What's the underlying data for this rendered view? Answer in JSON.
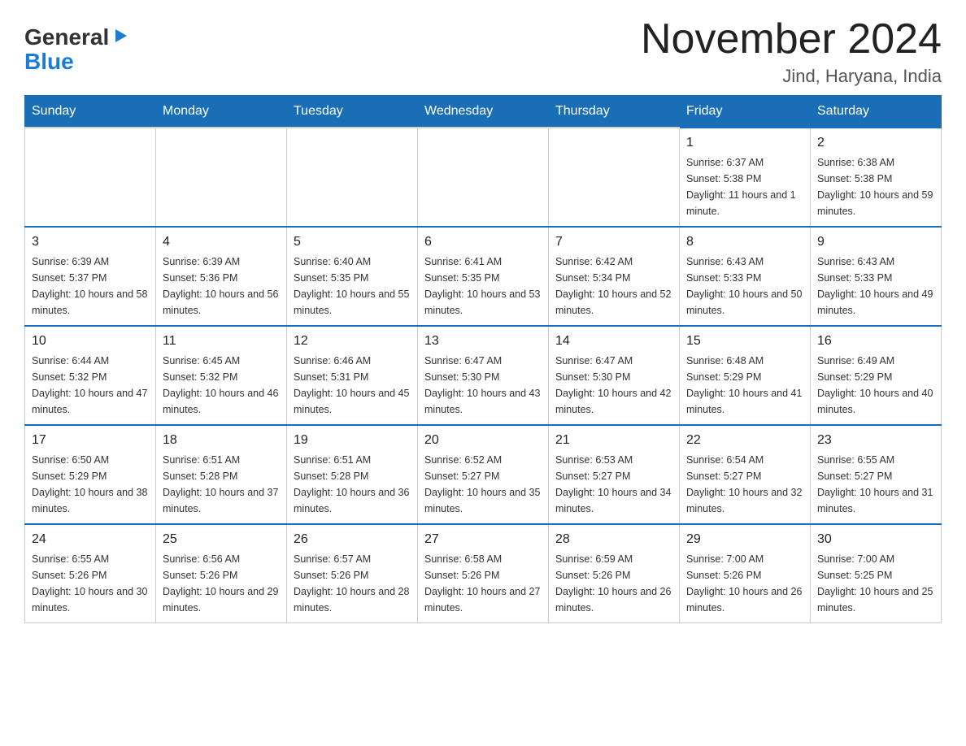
{
  "header": {
    "logo_general": "General",
    "logo_blue": "Blue",
    "month_title": "November 2024",
    "subtitle": "Jind, Haryana, India"
  },
  "days_of_week": [
    "Sunday",
    "Monday",
    "Tuesday",
    "Wednesday",
    "Thursday",
    "Friday",
    "Saturday"
  ],
  "weeks": [
    [
      {
        "num": "",
        "info": ""
      },
      {
        "num": "",
        "info": ""
      },
      {
        "num": "",
        "info": ""
      },
      {
        "num": "",
        "info": ""
      },
      {
        "num": "",
        "info": ""
      },
      {
        "num": "1",
        "info": "Sunrise: 6:37 AM\nSunset: 5:38 PM\nDaylight: 11 hours and 1 minute."
      },
      {
        "num": "2",
        "info": "Sunrise: 6:38 AM\nSunset: 5:38 PM\nDaylight: 10 hours and 59 minutes."
      }
    ],
    [
      {
        "num": "3",
        "info": "Sunrise: 6:39 AM\nSunset: 5:37 PM\nDaylight: 10 hours and 58 minutes."
      },
      {
        "num": "4",
        "info": "Sunrise: 6:39 AM\nSunset: 5:36 PM\nDaylight: 10 hours and 56 minutes."
      },
      {
        "num": "5",
        "info": "Sunrise: 6:40 AM\nSunset: 5:35 PM\nDaylight: 10 hours and 55 minutes."
      },
      {
        "num": "6",
        "info": "Sunrise: 6:41 AM\nSunset: 5:35 PM\nDaylight: 10 hours and 53 minutes."
      },
      {
        "num": "7",
        "info": "Sunrise: 6:42 AM\nSunset: 5:34 PM\nDaylight: 10 hours and 52 minutes."
      },
      {
        "num": "8",
        "info": "Sunrise: 6:43 AM\nSunset: 5:33 PM\nDaylight: 10 hours and 50 minutes."
      },
      {
        "num": "9",
        "info": "Sunrise: 6:43 AM\nSunset: 5:33 PM\nDaylight: 10 hours and 49 minutes."
      }
    ],
    [
      {
        "num": "10",
        "info": "Sunrise: 6:44 AM\nSunset: 5:32 PM\nDaylight: 10 hours and 47 minutes."
      },
      {
        "num": "11",
        "info": "Sunrise: 6:45 AM\nSunset: 5:32 PM\nDaylight: 10 hours and 46 minutes."
      },
      {
        "num": "12",
        "info": "Sunrise: 6:46 AM\nSunset: 5:31 PM\nDaylight: 10 hours and 45 minutes."
      },
      {
        "num": "13",
        "info": "Sunrise: 6:47 AM\nSunset: 5:30 PM\nDaylight: 10 hours and 43 minutes."
      },
      {
        "num": "14",
        "info": "Sunrise: 6:47 AM\nSunset: 5:30 PM\nDaylight: 10 hours and 42 minutes."
      },
      {
        "num": "15",
        "info": "Sunrise: 6:48 AM\nSunset: 5:29 PM\nDaylight: 10 hours and 41 minutes."
      },
      {
        "num": "16",
        "info": "Sunrise: 6:49 AM\nSunset: 5:29 PM\nDaylight: 10 hours and 40 minutes."
      }
    ],
    [
      {
        "num": "17",
        "info": "Sunrise: 6:50 AM\nSunset: 5:29 PM\nDaylight: 10 hours and 38 minutes."
      },
      {
        "num": "18",
        "info": "Sunrise: 6:51 AM\nSunset: 5:28 PM\nDaylight: 10 hours and 37 minutes."
      },
      {
        "num": "19",
        "info": "Sunrise: 6:51 AM\nSunset: 5:28 PM\nDaylight: 10 hours and 36 minutes."
      },
      {
        "num": "20",
        "info": "Sunrise: 6:52 AM\nSunset: 5:27 PM\nDaylight: 10 hours and 35 minutes."
      },
      {
        "num": "21",
        "info": "Sunrise: 6:53 AM\nSunset: 5:27 PM\nDaylight: 10 hours and 34 minutes."
      },
      {
        "num": "22",
        "info": "Sunrise: 6:54 AM\nSunset: 5:27 PM\nDaylight: 10 hours and 32 minutes."
      },
      {
        "num": "23",
        "info": "Sunrise: 6:55 AM\nSunset: 5:27 PM\nDaylight: 10 hours and 31 minutes."
      }
    ],
    [
      {
        "num": "24",
        "info": "Sunrise: 6:55 AM\nSunset: 5:26 PM\nDaylight: 10 hours and 30 minutes."
      },
      {
        "num": "25",
        "info": "Sunrise: 6:56 AM\nSunset: 5:26 PM\nDaylight: 10 hours and 29 minutes."
      },
      {
        "num": "26",
        "info": "Sunrise: 6:57 AM\nSunset: 5:26 PM\nDaylight: 10 hours and 28 minutes."
      },
      {
        "num": "27",
        "info": "Sunrise: 6:58 AM\nSunset: 5:26 PM\nDaylight: 10 hours and 27 minutes."
      },
      {
        "num": "28",
        "info": "Sunrise: 6:59 AM\nSunset: 5:26 PM\nDaylight: 10 hours and 26 minutes."
      },
      {
        "num": "29",
        "info": "Sunrise: 7:00 AM\nSunset: 5:26 PM\nDaylight: 10 hours and 26 minutes."
      },
      {
        "num": "30",
        "info": "Sunrise: 7:00 AM\nSunset: 5:25 PM\nDaylight: 10 hours and 25 minutes."
      }
    ]
  ]
}
